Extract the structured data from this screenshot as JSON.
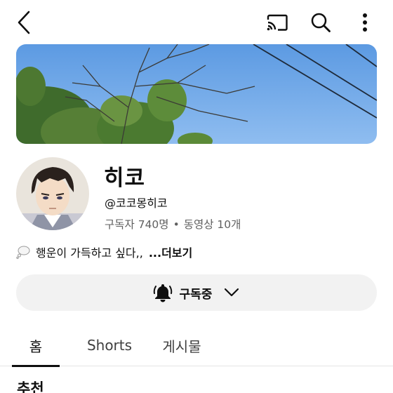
{
  "header": {
    "back_icon": "chevron-left-icon",
    "cast_icon": "cast-icon",
    "search_icon": "search-icon",
    "more_icon": "more-vert-icon"
  },
  "channel": {
    "name": "히코",
    "handle": "@코코몽히코",
    "subscribers": "구독자 740명",
    "separator": "•",
    "videos": "동영상 10개",
    "description": "행운이 가득하고 싶다,,",
    "description_more": "...더보기",
    "description_emoji": "thought-bubble-icon"
  },
  "subscribe": {
    "label": "구독중",
    "bell_icon": "bell-icon",
    "chevron_icon": "chevron-down-icon"
  },
  "tabs": [
    {
      "label": "홈",
      "active": true
    },
    {
      "label": "Shorts",
      "active": false
    },
    {
      "label": "게시물",
      "active": false
    }
  ],
  "section": {
    "title": "추천"
  }
}
